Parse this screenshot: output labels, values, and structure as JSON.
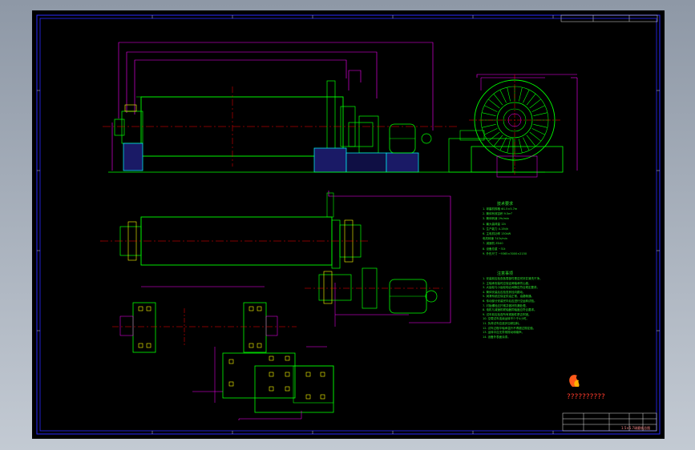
{
  "drawing": {
    "header_text": "",
    "tech_requirements_title": "技术要求",
    "tech_requirements": [
      "1. 球磨机规格 Φ1.5×5.7m",
      "2. 筒体有效容积 9.5m³",
      "3. 筒体转速 29r/min",
      "4. 最大装球量 12t",
      "5. 生产能力 4-15t/h",
      "6. 主电机功率 130kW",
      "   电机转速 743r/min",
      "7. 减速机 ZD40",
      "8. 设备总重 ~31t",
      "9. 外形尺寸 ~9365×3000×2150"
    ],
    "notes_title": "注意事项",
    "notes": [
      "1. 安装前应检查各零部件是否完好并清洗干净。",
      "2. 主轴承安装时应保证两轴承同心度。",
      "3. 大齿轮与小齿轮啮合间隙应符合规定要求。",
      "4. 筒体安装后应检查其径向跳动。",
      "5. 润滑系统应保证供油正常、油路畅通。",
      "6. 传动部分安装完毕后应进行空运转试验。",
      "7. 衬板螺栓应拧紧并做好防漏处理。",
      "8. 电机与减速机联轴器同轴度应符合要求。",
      "9. 试车前应检查所有紧固件是否牢固。",
      "10. 空载试车连续运转不少于4小时。",
      "11. 负荷试车应逐步加球加料。",
      "12. 试车过程中轴承温升不得超过规定值。",
      "13. 运转中应无异常振动和噪声。",
      "14. 设备外表面涂漆。"
    ],
    "logo_text": "??????????",
    "logo_subtext": "",
    "title_block_name": "1.5×5.7球磨机总图"
  },
  "colors": {
    "frame": "#0000ff",
    "outline": "#00ff00",
    "dimension": "#ff00ff",
    "centerline": "#ff0000",
    "foundation": "#00ffff",
    "hatch": "#5555ff",
    "motor": "#00ff00"
  }
}
